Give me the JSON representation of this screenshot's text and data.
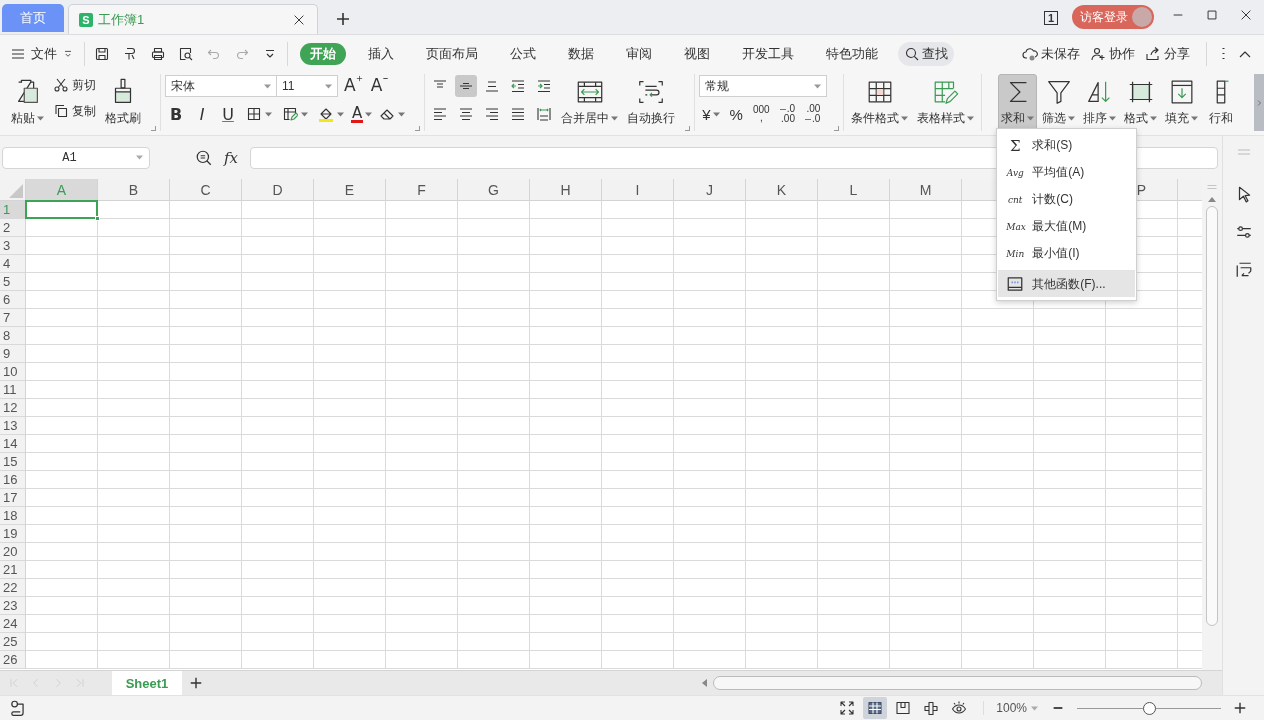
{
  "title_bar": {
    "tabs": [
      {
        "label": "首页",
        "kind": "home",
        "selected": false
      },
      {
        "label": "工作簿1",
        "kind": "workbook",
        "icon_letter": "S",
        "selected": true
      }
    ],
    "page_count": "1",
    "login": "访客登录"
  },
  "menu_bar": {
    "file": "文件",
    "tabs": [
      {
        "label": "开始",
        "selected": true
      },
      {
        "label": "插入",
        "selected": false
      },
      {
        "label": "页面布局",
        "selected": false
      },
      {
        "label": "公式",
        "selected": false
      },
      {
        "label": "数据",
        "selected": false
      },
      {
        "label": "审阅",
        "selected": false
      },
      {
        "label": "视图",
        "selected": false
      },
      {
        "label": "开发工具",
        "selected": false
      },
      {
        "label": "特色功能",
        "selected": false
      }
    ],
    "search": "查找",
    "actions": [
      {
        "kind": "cloud",
        "label": "未保存"
      },
      {
        "kind": "collab",
        "label": "协作"
      },
      {
        "kind": "share",
        "label": "分享"
      }
    ]
  },
  "ribbon": {
    "clipboard": {
      "paste": "粘贴",
      "cut": "剪切",
      "copy": "复制",
      "format_painter": "格式刷"
    },
    "font": {
      "name": "宋体",
      "size": "11",
      "grow": "A",
      "shrink": "A",
      "bold": "B",
      "italic": "I",
      "underline": "U",
      "font_color": "A"
    },
    "alignment": {
      "buttons": [
        {
          "kind": "top",
          "selected": false
        },
        {
          "kind": "middle",
          "selected": true
        },
        {
          "kind": "bottom",
          "selected": false
        },
        {
          "kind": "outdent",
          "selected": false
        },
        {
          "kind": "indent",
          "selected": false
        },
        {
          "kind": "left",
          "selected": false
        },
        {
          "kind": "center",
          "selected": false
        },
        {
          "kind": "right",
          "selected": false
        },
        {
          "kind": "justify",
          "selected": false
        },
        {
          "kind": "distributed",
          "selected": false
        }
      ],
      "merge": "合并居中",
      "wrap": "自动换行"
    },
    "number": {
      "format": "常规",
      "currency": "¥",
      "percent": "%",
      "thousands": "000",
      "thousands_mark": ",",
      "decimals": [
        {
          "kind": "increase",
          "top": ".0",
          "bottom": ".00"
        },
        {
          "kind": "decrease",
          "top": ".00",
          "bottom": ".0"
        }
      ]
    },
    "styles": [
      {
        "kind": "conditional",
        "label": "条件格式"
      },
      {
        "kind": "table",
        "label": "表格样式"
      }
    ],
    "editing": [
      {
        "kind": "sum",
        "label": "求和",
        "selected": true
      },
      {
        "kind": "filter",
        "label": "筛选",
        "selected": false
      },
      {
        "kind": "sort",
        "label": "排序",
        "selected": false
      },
      {
        "kind": "format",
        "label": "格式",
        "selected": false
      },
      {
        "kind": "fill",
        "label": "填充",
        "selected": false
      },
      {
        "kind": "rowcol",
        "label": "行和",
        "selected": false
      }
    ]
  },
  "formula_bar": {
    "name_box": "A1",
    "fx": "fx"
  },
  "sheet": {
    "columns": [
      {
        "label": "A",
        "selected": true
      },
      {
        "label": "B",
        "selected": false
      },
      {
        "label": "C",
        "selected": false
      },
      {
        "label": "D",
        "selected": false
      },
      {
        "label": "E",
        "selected": false
      },
      {
        "label": "F",
        "selected": false
      },
      {
        "label": "G",
        "selected": false
      },
      {
        "label": "H",
        "selected": false
      },
      {
        "label": "I",
        "selected": false
      },
      {
        "label": "J",
        "selected": false
      },
      {
        "label": "K",
        "selected": false
      },
      {
        "label": "L",
        "selected": false
      },
      {
        "label": "M",
        "selected": false
      },
      {},
      {},
      {
        "label": "P",
        "selected": false
      }
    ],
    "rows": [
      {
        "label": "1",
        "selected": true
      },
      {
        "label": "2",
        "selected": false
      },
      {
        "label": "3",
        "selected": false
      },
      {
        "label": "4",
        "selected": false
      },
      {
        "label": "5",
        "selected": false
      },
      {
        "label": "6",
        "selected": false
      },
      {
        "label": "7",
        "selected": false
      },
      {
        "label": "8",
        "selected": false
      },
      {
        "label": "9",
        "selected": false
      },
      {
        "label": "10",
        "selected": false
      },
      {
        "label": "11",
        "selected": false
      },
      {
        "label": "12",
        "selected": false
      },
      {
        "label": "13",
        "selected": false
      },
      {
        "label": "14",
        "selected": false
      },
      {
        "label": "15",
        "selected": false
      },
      {
        "label": "16",
        "selected": false
      },
      {
        "label": "17",
        "selected": false
      },
      {
        "label": "18",
        "selected": false
      },
      {
        "label": "19",
        "selected": false
      },
      {
        "label": "20",
        "selected": false
      },
      {
        "label": "21",
        "selected": false
      },
      {
        "label": "22",
        "selected": false
      },
      {
        "label": "23",
        "selected": false
      },
      {
        "label": "24",
        "selected": false
      },
      {
        "label": "25",
        "selected": false
      },
      {
        "label": "26",
        "selected": false
      }
    ]
  },
  "sum_menu": [
    {
      "kind": "sigma",
      "glyph": "Σ",
      "label": "求和(S)",
      "selected": false
    },
    {
      "kind": "text",
      "glyph": "Avg",
      "label": "平均值(A)",
      "selected": false
    },
    {
      "kind": "text",
      "glyph": "cnt",
      "label": "计数(C)",
      "selected": false
    },
    {
      "kind": "text",
      "glyph": "Max",
      "label": "最大值(M)",
      "selected": false
    },
    {
      "kind": "text",
      "glyph": "Min",
      "label": "最小值(I)",
      "selected": false
    },
    {
      "kind": "function",
      "label": "其他函数(F)...",
      "selected": true
    }
  ],
  "sheet_tabs": {
    "nav_disabled": true,
    "tabs": [
      {
        "label": "Sheet1",
        "selected": true
      }
    ]
  },
  "status_bar": {
    "views": [
      {
        "kind": "fullscreen",
        "selected": false
      },
      {
        "kind": "normal",
        "selected": true
      },
      {
        "kind": "page",
        "selected": false
      },
      {
        "kind": "reading",
        "selected": false
      },
      {
        "kind": "eye",
        "selected": false
      }
    ],
    "zoom": "100%",
    "zoom_slider": {
      "level": 0.5
    }
  }
}
